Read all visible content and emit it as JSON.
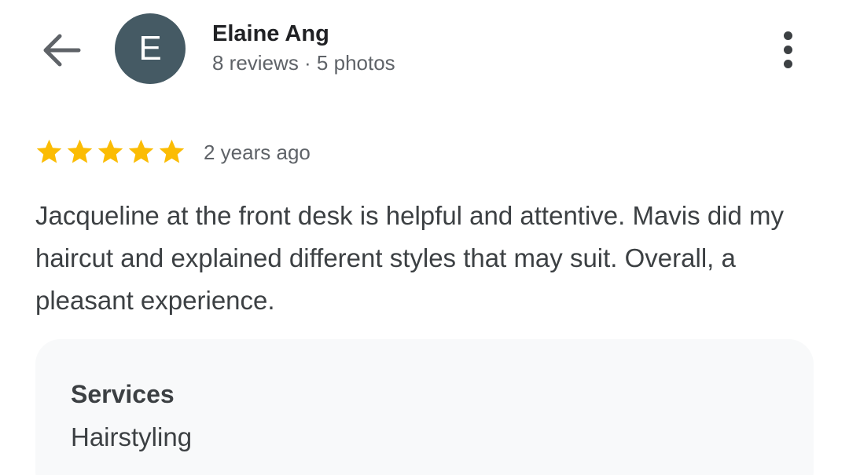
{
  "header": {
    "back_icon": "arrow-back-icon",
    "avatar": {
      "initial": "E",
      "color": "#455a64"
    },
    "reviewer_name": "Elaine Ang",
    "reviewer_meta": "8 reviews · 5 photos",
    "more_icon": "more-vert-icon"
  },
  "review": {
    "rating": 5,
    "max_rating": 5,
    "star_color": "#fbbc04",
    "date": "2 years ago",
    "text": "Jacqueline at the front desk is helpful and attentive. Mavis did my haircut and explained different styles that may suit. Overall, a pleasant experience."
  },
  "services": {
    "title": "Services",
    "value": "Hairstyling"
  }
}
